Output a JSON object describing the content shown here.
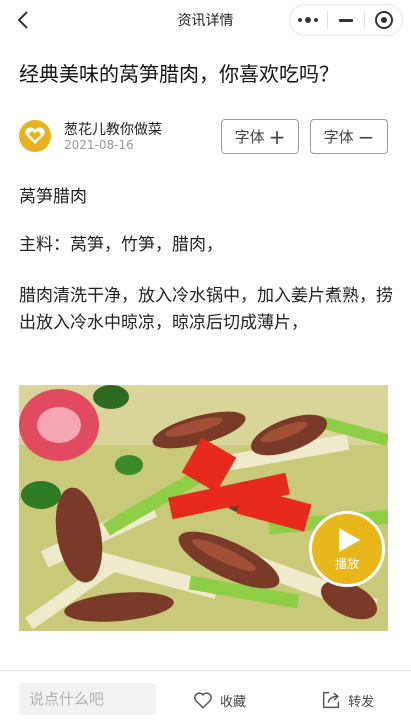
{
  "navbar": {
    "title": "资讯详情",
    "back_icon": "chevron-left-icon",
    "more_icon": "more-dots-icon",
    "minimize_icon": "minimize-icon",
    "close_icon": "target-circle-icon"
  },
  "article": {
    "title": "经典美味的莴笋腊肉，你喜欢吃吗？",
    "author": {
      "name": "葱花儿教你做菜",
      "date": "2021-08-16",
      "avatar_icon": "heart-logo-icon",
      "avatar_color": "#e9b21f"
    },
    "font_increase_label": "字体",
    "font_increase_symbol": "+",
    "font_decrease_label": "字体",
    "font_decrease_symbol": "−",
    "paragraphs": [
      "莴笋腊肉",
      "主料：莴笋，竹笋，腊肉，",
      "腊肉清洗干净，放入冷水锅中，加入姜片煮熟，捞出放入冷水中晾凉，晾凉后切成薄片，"
    ],
    "video": {
      "play_label": "播放",
      "play_icon": "play-icon",
      "accent_color": "#e8b71c"
    }
  },
  "bottom_bar": {
    "comment_placeholder": "说点什么吧",
    "collect_label": "收藏",
    "collect_icon": "heart-outline-icon",
    "share_label": "转发",
    "share_icon": "share-icon"
  }
}
